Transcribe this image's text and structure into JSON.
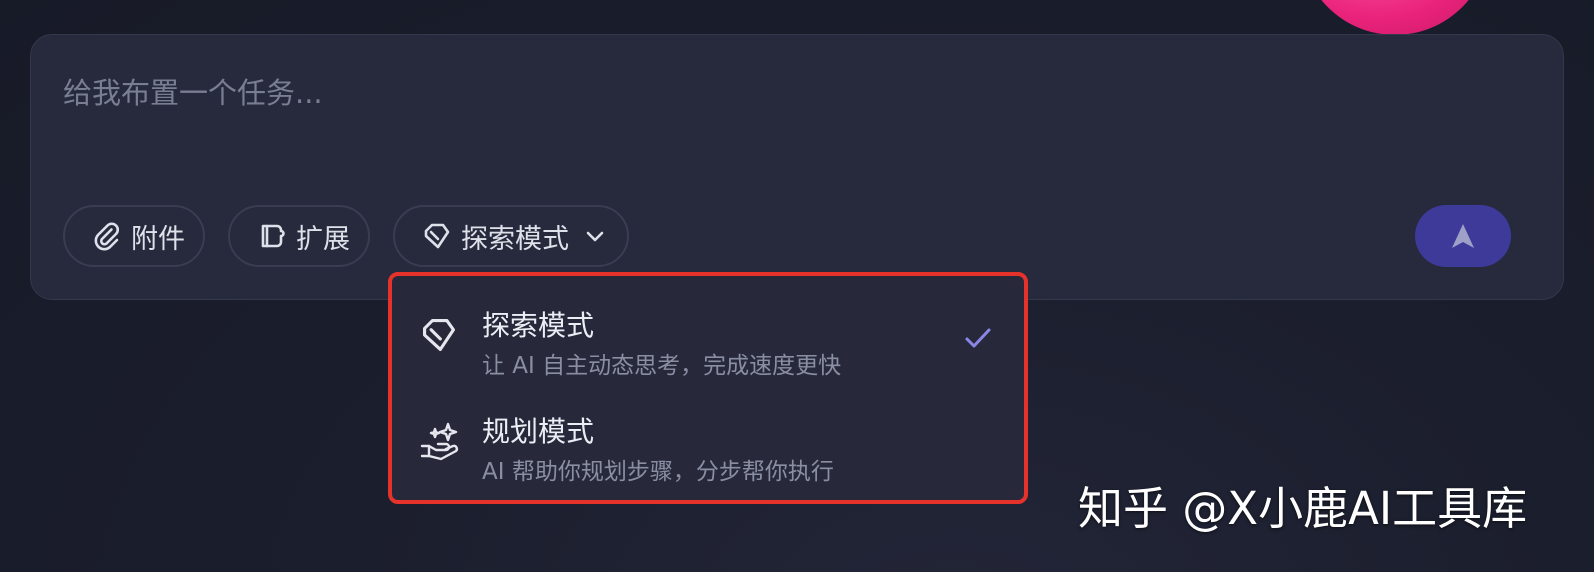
{
  "composer": {
    "placeholder": "给我布置一个任务...",
    "attach_label": "附件",
    "extend_label": "扩展",
    "mode_label": "探索模式"
  },
  "mode_menu": {
    "options": [
      {
        "title": "探索模式",
        "description": "让 AI 自主动态思考，完成速度更快",
        "selected": true,
        "icon": "tag-icon"
      },
      {
        "title": "规划模式",
        "description": "AI 帮助你规划步骤，分步帮你执行",
        "selected": false,
        "icon": "hand-sparkle-icon"
      }
    ]
  },
  "watermark": "知乎 @X小鹿AI工具库",
  "colors": {
    "accent": "#3d3a9a",
    "check": "#8b86e6",
    "highlight_border": "#e5322a",
    "panel": "#262a3c"
  }
}
